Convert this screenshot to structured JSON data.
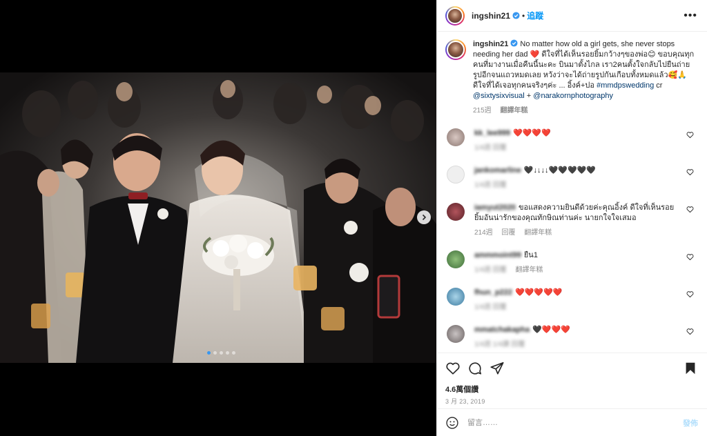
{
  "media": {
    "carousel_dots": 5,
    "active_dot": 0
  },
  "header": {
    "username": "ingshin21",
    "separator": "•",
    "follow_label": "追蹤",
    "more_label": "•••"
  },
  "caption": {
    "username": "ingshin21",
    "text_part1": "No matter how old a girl gets, she never stops needing her dad ",
    "emoji1": "❤️",
    "text_part2": " ดีใจที่ได้เห็นรอยยิ้มกว้างๆของพ่อ",
    "emoji2": "😊",
    "text_part3": " ขอบคุณทุกคนที่มางานเมื่อคืนนี้นะคะ บินมาตั้งไกล เรา2คนตั้งใจกลับไปยืนถ่ายรูปอีกจนแถวหมดเลย หวังว่าจะได้ถ่ายรูปกันเกือบทั้งหมดแล้ว",
    "emoji3": "🥰🙏",
    "text_part4": " ดีใจที่ได้เจอทุกคนจริงๆค่ะ ... อิ้งค์+ปอ ",
    "hashtag": "#mmdpswedding",
    "text_part5": " cr ",
    "mention1": "@sixtysixvisual",
    "plus": " + ",
    "mention2": "@narakornphotography",
    "time": "215週",
    "translate": "翻譯年糕"
  },
  "comments": [
    {
      "user": "kk_lee999",
      "text": "❤️❤️❤️❤️",
      "kind": "hearts-red",
      "time": "215週",
      "likes": "",
      "reply": "",
      "translate": "",
      "meta_blurred": "1/4週 回覆"
    },
    {
      "user": "jankomarline",
      "text": "🖤↓↓↓↓🖤🖤🖤🖤🖤",
      "kind": "hearts-black",
      "time": "",
      "likes": "",
      "reply": "",
      "translate": "",
      "meta_blurred": "1/4週 回覆"
    },
    {
      "user": "iamyut2020",
      "text": "ขอแสดงความยินดีด้วยค่ะคุณอิ้งค์ ดีใจที่เห็นรอยยิ้มอันน่ารักของคุณทักษิณท่านค่ะ นายกใจใจเสมอ",
      "kind": "text",
      "time": "214週",
      "likes": "",
      "reply": "回覆",
      "translate": "翻譯年糕",
      "meta_blurred": ""
    },
    {
      "user": "ammmoint99",
      "text": "ยืน1",
      "kind": "text",
      "time": "",
      "likes": "",
      "reply": "",
      "translate": "翻譯年糕",
      "meta_blurred": "1/4週 回覆"
    },
    {
      "user": "fhun_p222",
      "text": "❤️❤️❤️❤️❤️",
      "kind": "hearts-red",
      "time": "",
      "likes": "",
      "reply": "",
      "translate": "",
      "meta_blurred": "1/4週 回覆"
    },
    {
      "user": "mmatchakapha",
      "text": "🖤❤️❤️❤️",
      "kind": "hearts-mixed",
      "time": "",
      "likes": "",
      "reply": "",
      "translate": "",
      "meta_blurred": "1/4週 1/4讚 回覆"
    }
  ],
  "actions": {
    "likes": "4.6萬個讚",
    "date": "3 月 23, 2019"
  },
  "add_comment": {
    "placeholder": "留言……",
    "post_label": "發佈"
  }
}
